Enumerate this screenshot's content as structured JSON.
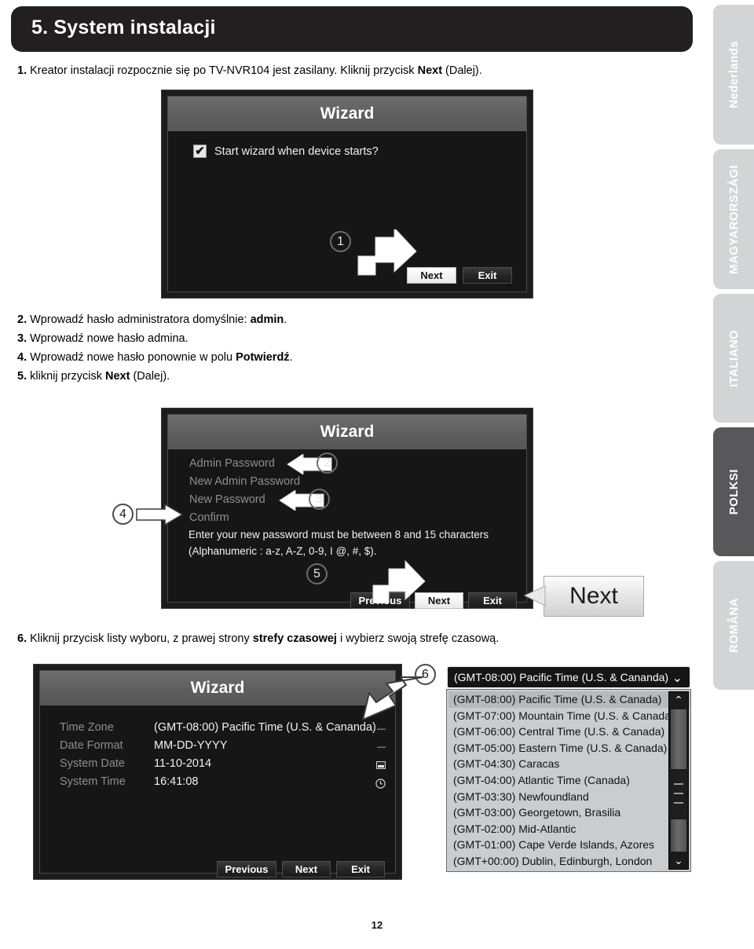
{
  "header": {
    "title": "5. System instalacji"
  },
  "instructions": {
    "step1": {
      "num": "1.",
      "text_before": " Kreator instalacji rozpocznie się po TV-NVR104 jest zasilany. Kliknij przycisk ",
      "bold": "Next",
      "text_after": " (Dalej)."
    },
    "step2": {
      "num": "2.",
      "text_before": " Wprowadź hasło administratora domyślnie: ",
      "bold": "admin",
      "text_after": "."
    },
    "step3": {
      "num": "3.",
      "text_before": " Wprowadź nowe hasło admina.",
      "bold": "",
      "text_after": ""
    },
    "step4": {
      "num": "4.",
      "text_before": " Wprowadź nowe hasło ponownie w polu ",
      "bold": "Potwierdź",
      "text_after": "."
    },
    "step5": {
      "num": "5.",
      "text_before": " kliknij przycisk ",
      "bold": "Next",
      "text_after": " (Dalej)."
    },
    "step6": {
      "num": "6.",
      "text_before": " Kliknij przycisk listy wyboru, z prawej strony ",
      "bold": "strefy czasowej",
      "text_after": " i wybierz swoją strefę czasową."
    }
  },
  "wizard1": {
    "title": "Wizard",
    "checkbox_label": "Start wizard when device starts?",
    "checkbox_checked": "✔",
    "next_label": "Next",
    "exit_label": "Exit",
    "callout": "1"
  },
  "wizard2": {
    "title": "Wizard",
    "fields": [
      {
        "label": "Admin Password"
      },
      {
        "label": "New Admin Password"
      },
      {
        "label": "New Password"
      },
      {
        "label": "Confirm"
      }
    ],
    "help_line1": "Enter your new password must be between 8 and 15 characters",
    "help_line2": "(Alphanumeric : a-z, A-Z, 0-9, I @, #, $).",
    "previous_label": "Previous",
    "next_label": "Next",
    "exit_label": "Exit",
    "callout_2": "2",
    "callout_3": "3",
    "callout_4": "4",
    "callout_5": "5",
    "zoom_bubble_label": "Next"
  },
  "wizard3": {
    "title": "Wizard",
    "rows": [
      {
        "label": "Time Zone",
        "value": "(GMT-08:00) Pacific Time (U.S. & Cananda)",
        "icon": "dash-icon"
      },
      {
        "label": "Date Format",
        "value": "MM-DD-YYYY",
        "icon": "dash-icon"
      },
      {
        "label": "System Date",
        "value": "11-10-2014",
        "icon": "calendar-icon"
      },
      {
        "label": "System Time",
        "value": "16:41:08",
        "icon": "clock-icon"
      }
    ],
    "previous_label": "Previous",
    "next_label": "Next",
    "exit_label": "Exit",
    "callout": "6"
  },
  "dropdown": {
    "selected": "(GMT-08:00) Pacific Time (U.S. & Cananda)",
    "chevron": "⌄",
    "scroll_up": "⌃",
    "scroll_down": "⌄",
    "options": [
      "(GMT-08:00) Pacific Time (U.S. & Canada)",
      "(GMT-07:00) Mountain Time (U.S. & Canada)",
      "(GMT-06:00) Central Time (U.S. & Canada)",
      "(GMT-05:00) Eastern Time (U.S. & Canada)",
      "(GMT-04:30) Caracas",
      "(GMT-04:00) Atlantic Time (Canada)",
      "(GMT-03:30) Newfoundland",
      "(GMT-03:00) Georgetown, Brasilia",
      "(GMT-02:00) Mid-Atlantic",
      "(GMT-01:00) Cape Verde Islands, Azores",
      "(GMT+00:00) Dublin, Edinburgh, London"
    ],
    "selected_index": 0
  },
  "language_tabs": [
    {
      "label": "Nederlands",
      "active": false
    },
    {
      "label": "MAGYARORSZÁGI",
      "active": false
    },
    {
      "label": "ITALIANO",
      "active": false
    },
    {
      "label": "POLKSI",
      "active": true
    },
    {
      "label": "ROMÂNA",
      "active": false
    }
  ],
  "page_number": "12",
  "colors": {
    "header_bg": "#231f20",
    "tab_active": "#58585a",
    "tab_inactive": "#d2d4d6"
  }
}
